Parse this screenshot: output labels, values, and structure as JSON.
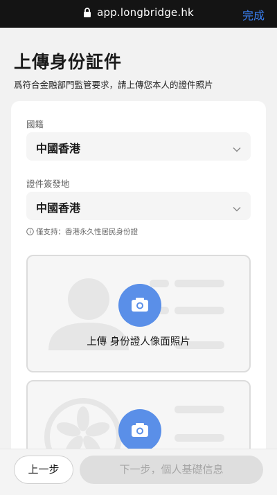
{
  "browser": {
    "url": "app.longbridge.hk",
    "done_label": "完成"
  },
  "page": {
    "title": "上傳身份証件",
    "subtitle": "爲符合金融部門監管要求，請上傳您本人的證件照片"
  },
  "form": {
    "nationality": {
      "label": "國籍",
      "value": "中國香港"
    },
    "issuing_place": {
      "label": "證件簽發地",
      "value": "中國香港"
    },
    "hint": "僅支持：香港永久性居民身份證"
  },
  "uploads": [
    {
      "label": "上傳 身份證人像面照片"
    },
    {
      "label": ""
    }
  ],
  "footer": {
    "prev_label": "上一步",
    "next_label": "下一步，個人基礎信息"
  },
  "colors": {
    "accent": "#5a8fe8",
    "link": "#3b82f6",
    "disabled_bg": "#dedede",
    "disabled_text": "#a6a6a6"
  }
}
